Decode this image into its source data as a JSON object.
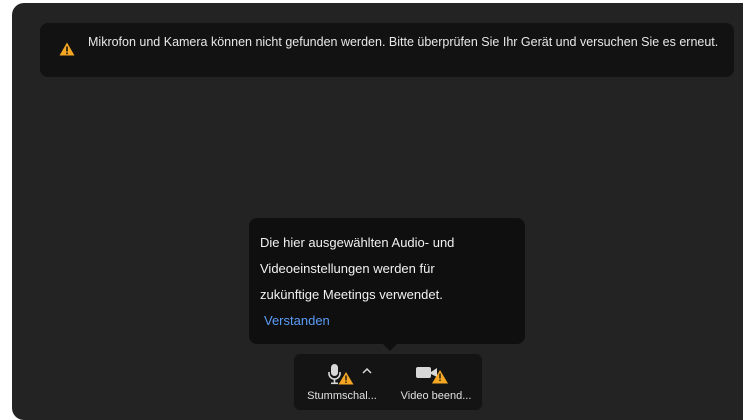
{
  "banner": {
    "icon": "warning-icon",
    "text": "Mikrofon und Kamera können nicht gefunden werden. Bitte überprüfen Sie Ihr Gerät und versuchen Sie es erneut."
  },
  "tooltip": {
    "lines": [
      "Die hier ausgewählten Audio- und",
      "Videoeinstellungen werden für",
      "zukünftige Meetings verwendet."
    ],
    "action_label": "Verstanden"
  },
  "toolbar": {
    "mute": {
      "label": "Stummschal...",
      "icon": "microphone-warning-icon"
    },
    "audio_options": {
      "icon": "chevron-up-icon"
    },
    "video": {
      "label": "Video beend...",
      "icon": "camera-warning-icon"
    }
  },
  "colors": {
    "background": "#232323",
    "banner_bg": "#121212",
    "tooltip_bg": "#0f0f0f",
    "link": "#5b9cf5",
    "warning": "#f5a623"
  }
}
